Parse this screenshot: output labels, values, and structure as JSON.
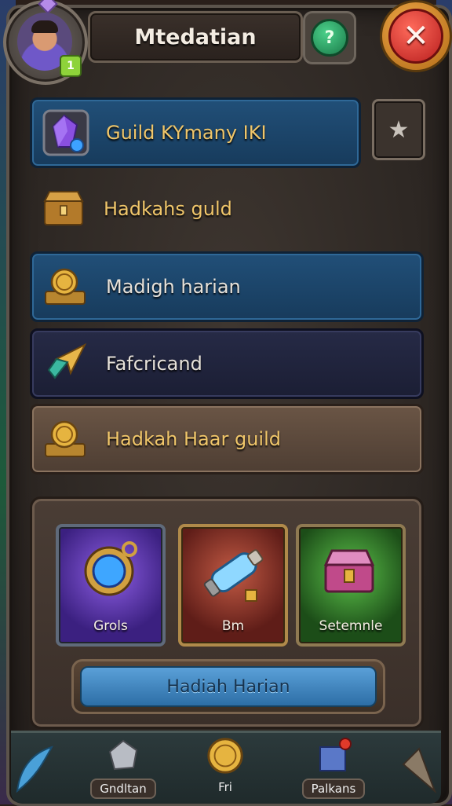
{
  "header": {
    "title": "Mtedatian"
  },
  "avatar": {
    "level": "1"
  },
  "menu": [
    {
      "label": "Guild KYmany IKI",
      "style": "blue",
      "icon": "purple-crystal-icon"
    },
    {
      "label": "Hadkahs guld",
      "style": "plain",
      "icon": "treasure-chest-icon"
    },
    {
      "label": "Madigh harian",
      "style": "blue",
      "icon": "gold-coins-icon"
    },
    {
      "label": "Fafcricand",
      "style": "navy",
      "icon": "golden-arrow-icon"
    },
    {
      "label": "Hadkah Haar guild",
      "style": "wood",
      "icon": "gold-coins-icon"
    }
  ],
  "rewards": {
    "cards": [
      {
        "label": "Grols",
        "icon": "amulet-icon"
      },
      {
        "label": "Bm",
        "icon": "potion-icon"
      },
      {
        "label": "Setemnle",
        "icon": "treasure-chest-icon"
      }
    ],
    "claim_label": "Hadiah Harian"
  },
  "nav": [
    {
      "label": "Gndltan",
      "icon": "silver-ore-icon"
    },
    {
      "label": "Fri",
      "icon": "gold-coin-icon"
    },
    {
      "label": "Palkans",
      "icon": "crystal-box-icon"
    }
  ],
  "colors": {
    "gold_text": "#f0c66a",
    "row_blue": "#1f4a70",
    "close_red": "#c82a22",
    "help_green": "#2aa866"
  }
}
